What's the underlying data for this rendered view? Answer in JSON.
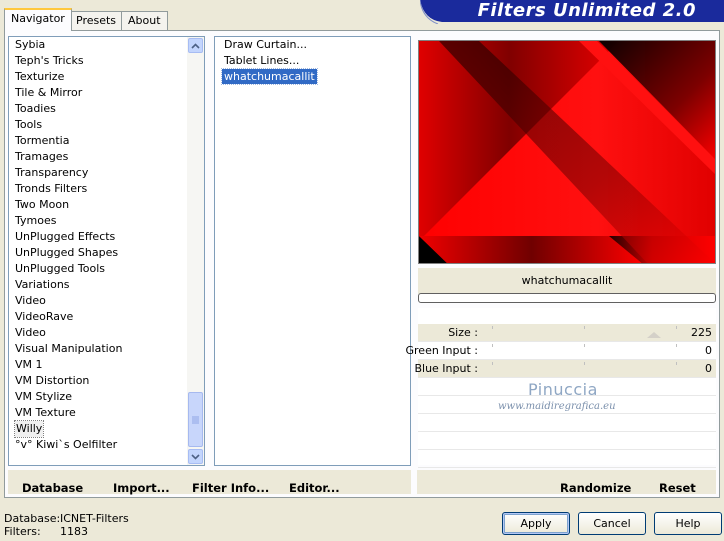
{
  "banner": {
    "title": "Filters Unlimited 2.0"
  },
  "tabs": [
    {
      "label": "Navigator",
      "active": true
    },
    {
      "label": "Presets",
      "active": false
    },
    {
      "label": "About",
      "active": false
    }
  ],
  "categories": {
    "items": [
      "Sybia",
      "Teph's Tricks",
      "Texturize",
      "Tile & Mirror",
      "Toadies",
      "Tools",
      "Tormentia",
      "Tramages",
      "Transparency",
      "Tronds Filters",
      "Two Moon",
      "Tymoes",
      "UnPlugged Effects",
      "UnPlugged Shapes",
      "UnPlugged Tools",
      "Variations",
      "Video",
      "VideoRave",
      "Video",
      "Visual Manipulation",
      "VM 1",
      "VM Distortion",
      "VM Stylize",
      "VM Texture",
      "Willy",
      "°v° Kiwi`s Oelfilter"
    ],
    "selected": "Willy"
  },
  "filters": {
    "items": [
      "Draw Curtain...",
      "Tablet Lines...",
      "whatchumacallit"
    ],
    "selected": "whatchumacallit"
  },
  "preview": {
    "filter_name": "whatchumacallit",
    "progress": 0
  },
  "params": [
    {
      "label": "Size :",
      "value": "225",
      "level": 225
    },
    {
      "label": "Green Input :",
      "value": "0",
      "level": 0
    },
    {
      "label": "Blue Input :",
      "value": "0",
      "level": 0
    }
  ],
  "watermark": {
    "name": "Pinuccia",
    "url": "www.maidiregrafica.eu"
  },
  "left_buttons": {
    "database": "Database",
    "import": "Import...",
    "filter_info": "Filter Info...",
    "editor": "Editor..."
  },
  "right_buttons": {
    "randomize": "Randomize",
    "reset": "Reset"
  },
  "status": {
    "database_label": "Database:",
    "database_value": "ICNET-Filters",
    "filters_label": "Filters:",
    "filters_value": "1183"
  },
  "dialog": {
    "apply": "Apply",
    "cancel": "Cancel",
    "help": "Help"
  },
  "colors": {
    "selection": "#316ac5",
    "banner": "#1a2a9c",
    "preview_red": "#ff0000"
  }
}
